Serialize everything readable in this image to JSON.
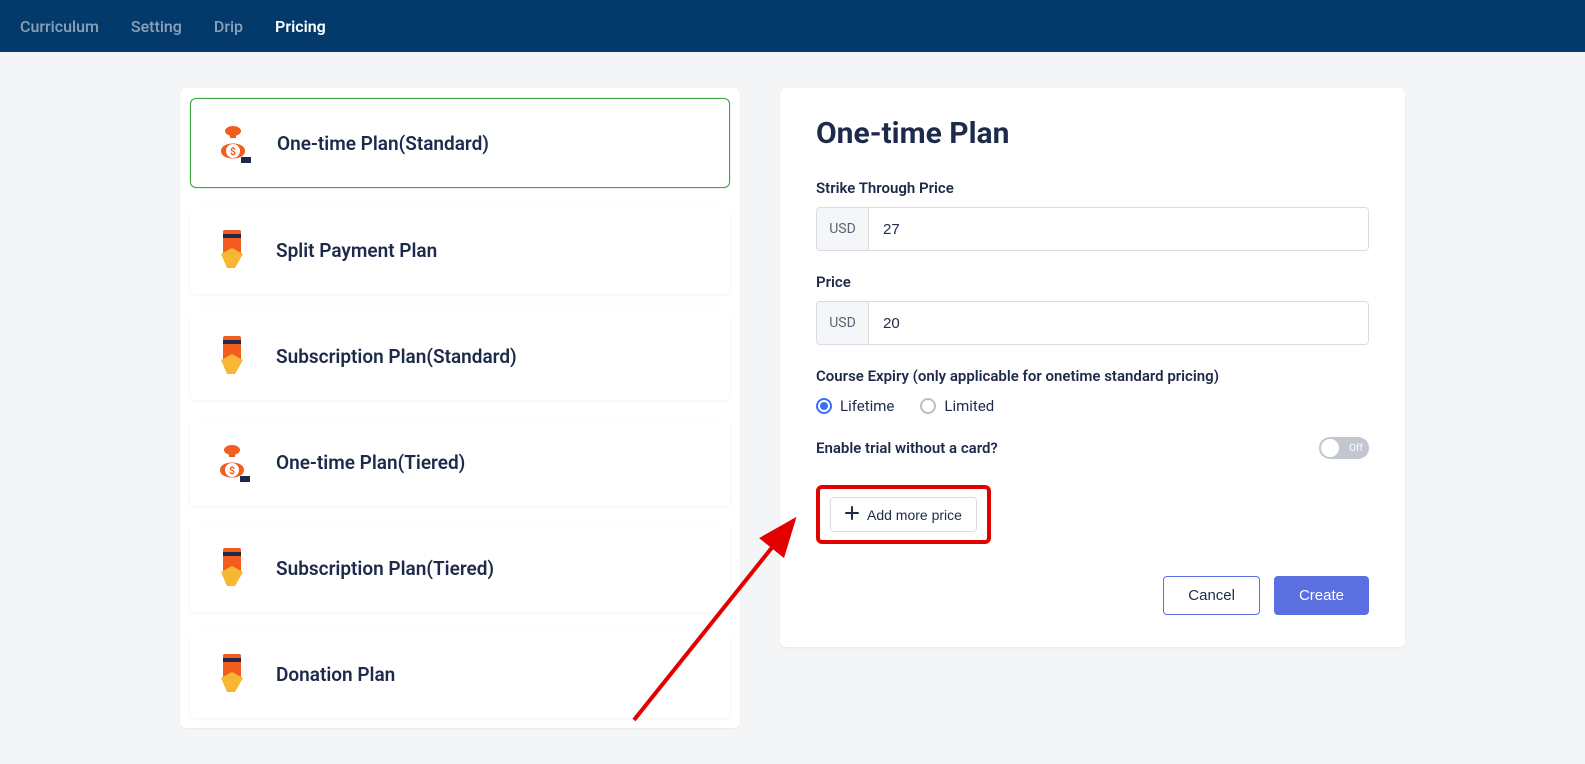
{
  "topbar": {
    "tabs": [
      {
        "label": "Curriculum"
      },
      {
        "label": "Setting"
      },
      {
        "label": "Drip"
      },
      {
        "label": "Pricing"
      }
    ],
    "activeIndex": 3
  },
  "plans": [
    {
      "label": "One-time Plan(Standard)",
      "iconType": "bag",
      "active": true
    },
    {
      "label": "Split Payment Plan",
      "iconType": "card",
      "active": false
    },
    {
      "label": "Subscription Plan(Standard)",
      "iconType": "card",
      "active": false
    },
    {
      "label": "One-time Plan(Tiered)",
      "iconType": "bag",
      "active": false
    },
    {
      "label": "Subscription Plan(Tiered)",
      "iconType": "card",
      "active": false
    },
    {
      "label": "Donation Plan",
      "iconType": "card",
      "active": false
    }
  ],
  "form": {
    "title": "One-time Plan",
    "strikeLabel": "Strike Through Price",
    "strikeCurrency": "USD",
    "strikeValue": "27",
    "priceLabel": "Price",
    "priceCurrency": "USD",
    "priceValue": "20",
    "expiryLabel": "Course Expiry (only applicable for onetime standard pricing)",
    "expiryOptions": {
      "lifetime": "Lifetime",
      "limited": "Limited"
    },
    "expirySelected": "lifetime",
    "trialLabel": "Enable trial without a card?",
    "toggleText": "Off",
    "addMoreLabel": "Add more price",
    "cancelLabel": "Cancel",
    "createLabel": "Create"
  }
}
